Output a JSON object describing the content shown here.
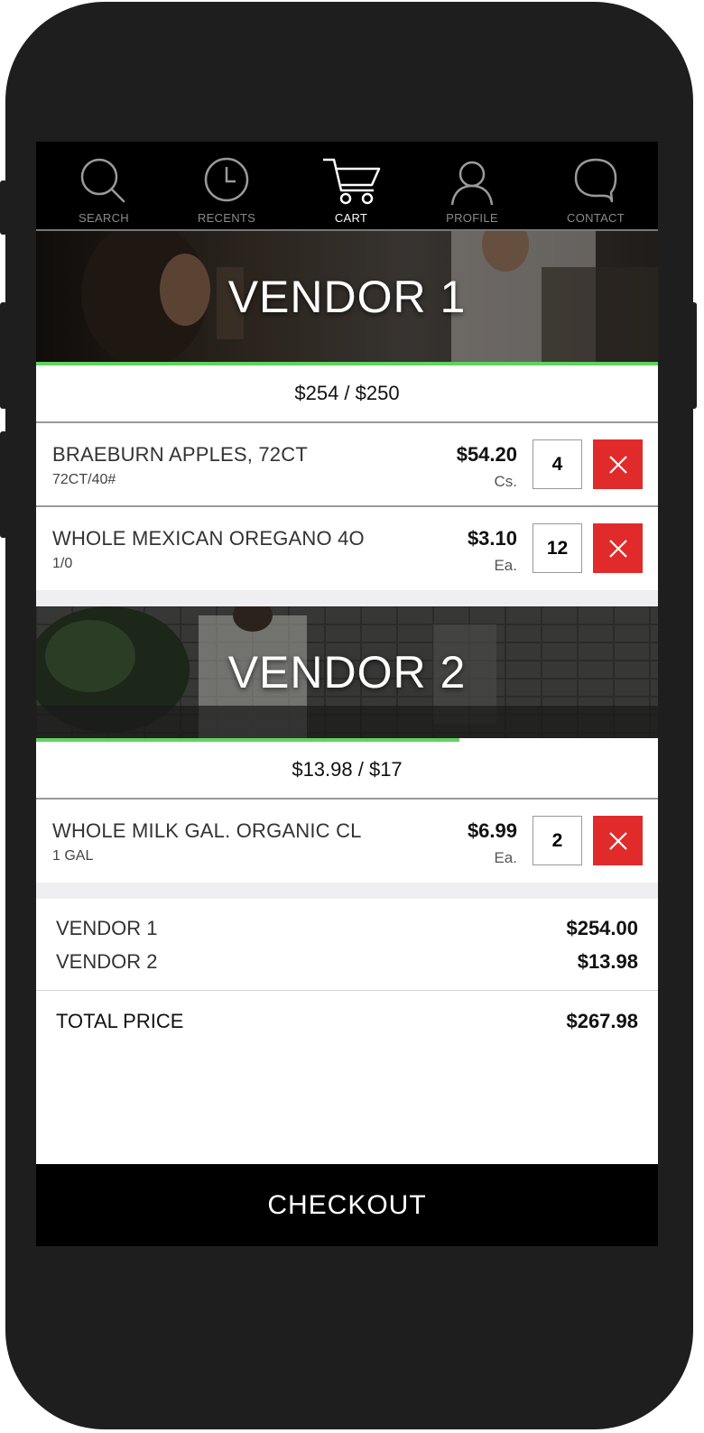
{
  "nav": {
    "items": [
      {
        "label": "SEARCH",
        "icon": "search-icon",
        "active": false
      },
      {
        "label": "RECENTS",
        "icon": "clock-icon",
        "active": false
      },
      {
        "label": "CART",
        "icon": "cart-icon",
        "active": true
      },
      {
        "label": "PROFILE",
        "icon": "user-icon",
        "active": false
      },
      {
        "label": "CONTACT",
        "icon": "chat-bubble-icon",
        "active": false
      }
    ]
  },
  "vendors": [
    {
      "title": "VENDOR 1",
      "subtotal": "$254 / $250",
      "progress_fraction": 1.0,
      "items": [
        {
          "name": "BRAEBURN APPLES, 72CT",
          "pack": "72CT/40#",
          "price": "$54.20",
          "unit": "Cs.",
          "qty": "4"
        },
        {
          "name": "WHOLE MEXICAN OREGANO 4O",
          "pack": "1/0",
          "price": "$3.10",
          "unit": "Ea.",
          "qty": "12"
        }
      ]
    },
    {
      "title": "VENDOR 2",
      "subtotal": "$13.98 / $17",
      "progress_fraction": 0.68,
      "items": [
        {
          "name": "WHOLE MILK GAL. ORGANIC CL",
          "pack": "1 GAL",
          "price": "$6.99",
          "unit": "Ea.",
          "qty": "2"
        }
      ]
    }
  ],
  "summary": {
    "lines": [
      {
        "label": "VENDOR 1",
        "value": "$254.00"
      },
      {
        "label": "VENDOR 2",
        "value": "$13.98"
      }
    ],
    "total_label": "TOTAL PRICE",
    "total_value": "$267.98"
  },
  "checkout_label": "CHECKOUT",
  "colors": {
    "accent_progress": "#5fd35f",
    "remove_button": "#e12b2b",
    "navbar_bg": "#000000"
  }
}
